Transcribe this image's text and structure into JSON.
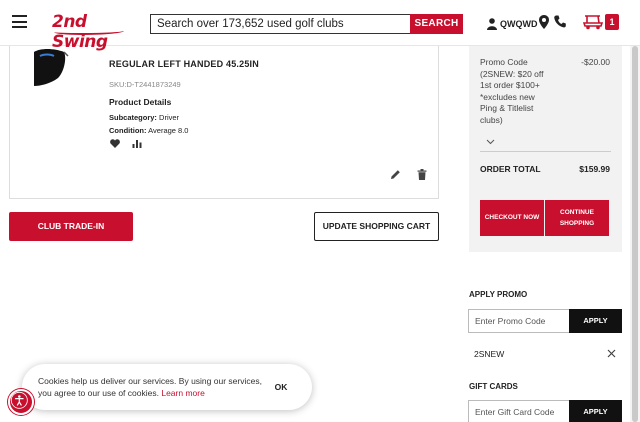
{
  "header": {
    "logo_text": "2nd Swing",
    "search_placeholder": "Search over 173,652 used golf clubs",
    "search_button": "SEARCH",
    "user_name": "QWQWD",
    "cart_count": "1"
  },
  "cart_item": {
    "title": "REGULAR LEFT HANDED 45.25IN",
    "sku": "SKU:D-T2441873249",
    "details_heading": "Product Details",
    "subcategory_label": "Subcategory:",
    "subcategory_value": "Driver",
    "condition_label": "Condition:",
    "condition_value": "Average 8.0"
  },
  "actions": {
    "trade_in": "CLUB TRADE-IN",
    "update_cart": "UPDATE SHOPPING CART"
  },
  "summary": {
    "promo_label": "Promo Code (2SNEW: $20 off 1st order $100+ *excludes new Ping & Titlelist clubs)",
    "promo_amount": "-$20.00",
    "order_total_label": "ORDER TOTAL",
    "order_total_value": "$159.99",
    "checkout": "CHECKOUT NOW",
    "continue_line1": "CONTINUE",
    "continue_line2": "SHOPPING"
  },
  "promo": {
    "title": "APPLY PROMO",
    "placeholder": "Enter Promo Code",
    "apply": "APPLY",
    "applied_code": "2SNEW"
  },
  "gift": {
    "title": "GIFT CARDS",
    "placeholder": "Enter Gift Card Code",
    "apply": "APPLY"
  },
  "cookie": {
    "text": "Cookies help us deliver our services. By using our services, you agree to our use of cookies.",
    "link": "Learn more",
    "ok": "OK"
  },
  "colors": {
    "brand_red": "#c8102e",
    "dark": "#111111",
    "summary_bg": "#f2f2f2"
  }
}
